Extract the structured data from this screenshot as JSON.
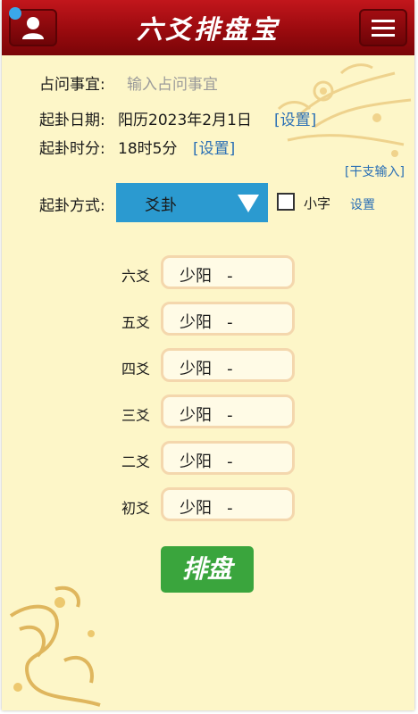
{
  "header": {
    "title": "六爻排盘宝",
    "user_icon": "user-icon",
    "menu_icon": "menu-icon",
    "accent": "#a10f14"
  },
  "form": {
    "matter_label": "占问事宜:",
    "matter_placeholder": "输入占问事宜",
    "date_label": "起卦日期:",
    "date_value": "阳历2023年2月1日",
    "time_label": "起卦时分:",
    "time_value": "18时5分",
    "set_link": "[设置]",
    "ganzhi_link": "[干支输入]",
    "method_label": "起卦方式:",
    "method_selected": "爻卦",
    "small_char_label": "小字",
    "settings_link": "设置"
  },
  "yao_rows": [
    {
      "label": "六爻",
      "value": "少阳   -"
    },
    {
      "label": "五爻",
      "value": "少阳   -"
    },
    {
      "label": "四爻",
      "value": "少阳   -"
    },
    {
      "label": "三爻",
      "value": "少阳   -"
    },
    {
      "label": "二爻",
      "value": "少阳   -"
    },
    {
      "label": "初爻",
      "value": "少阳   -"
    }
  ],
  "paipan_button": "排盘",
  "colors": {
    "background": "#fdf6c8",
    "dropdown": "#2b9ad0",
    "button": "#3aa53d",
    "link": "#2a6fb5"
  }
}
